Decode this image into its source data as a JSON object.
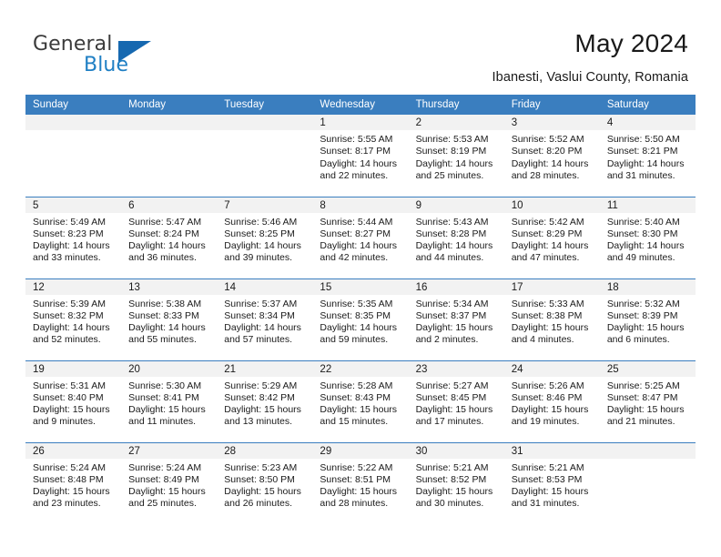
{
  "brand": {
    "name_part1": "General",
    "name_part2": "Blue",
    "triangle_icon": "triangle-logo-icon",
    "colors": {
      "general": "#3b3b3b",
      "blue": "#1f7fc4",
      "triangle": "#1668b0"
    }
  },
  "header": {
    "title": "May 2024",
    "location": "Ibanesti, Vaslui County, Romania"
  },
  "theme": {
    "header_bg": "#3a7ebf",
    "header_text": "#ffffff",
    "daynum_bg": "#f2f2f2",
    "divider": "#3a7ebf",
    "body_text": "#1a1a1a"
  },
  "weekdays": [
    "Sunday",
    "Monday",
    "Tuesday",
    "Wednesday",
    "Thursday",
    "Friday",
    "Saturday"
  ],
  "weeks": [
    [
      {
        "day": "",
        "sunrise": "",
        "sunset": "",
        "daylight1": "",
        "daylight2": "",
        "blank": true
      },
      {
        "day": "",
        "sunrise": "",
        "sunset": "",
        "daylight1": "",
        "daylight2": "",
        "blank": true
      },
      {
        "day": "",
        "sunrise": "",
        "sunset": "",
        "daylight1": "",
        "daylight2": "",
        "blank": true
      },
      {
        "day": "1",
        "sunrise": "Sunrise: 5:55 AM",
        "sunset": "Sunset: 8:17 PM",
        "daylight1": "Daylight: 14 hours",
        "daylight2": "and 22 minutes.",
        "blank": false
      },
      {
        "day": "2",
        "sunrise": "Sunrise: 5:53 AM",
        "sunset": "Sunset: 8:19 PM",
        "daylight1": "Daylight: 14 hours",
        "daylight2": "and 25 minutes.",
        "blank": false
      },
      {
        "day": "3",
        "sunrise": "Sunrise: 5:52 AM",
        "sunset": "Sunset: 8:20 PM",
        "daylight1": "Daylight: 14 hours",
        "daylight2": "and 28 minutes.",
        "blank": false
      },
      {
        "day": "4",
        "sunrise": "Sunrise: 5:50 AM",
        "sunset": "Sunset: 8:21 PM",
        "daylight1": "Daylight: 14 hours",
        "daylight2": "and 31 minutes.",
        "blank": false
      }
    ],
    [
      {
        "day": "5",
        "sunrise": "Sunrise: 5:49 AM",
        "sunset": "Sunset: 8:23 PM",
        "daylight1": "Daylight: 14 hours",
        "daylight2": "and 33 minutes.",
        "blank": false
      },
      {
        "day": "6",
        "sunrise": "Sunrise: 5:47 AM",
        "sunset": "Sunset: 8:24 PM",
        "daylight1": "Daylight: 14 hours",
        "daylight2": "and 36 minutes.",
        "blank": false
      },
      {
        "day": "7",
        "sunrise": "Sunrise: 5:46 AM",
        "sunset": "Sunset: 8:25 PM",
        "daylight1": "Daylight: 14 hours",
        "daylight2": "and 39 minutes.",
        "blank": false
      },
      {
        "day": "8",
        "sunrise": "Sunrise: 5:44 AM",
        "sunset": "Sunset: 8:27 PM",
        "daylight1": "Daylight: 14 hours",
        "daylight2": "and 42 minutes.",
        "blank": false
      },
      {
        "day": "9",
        "sunrise": "Sunrise: 5:43 AM",
        "sunset": "Sunset: 8:28 PM",
        "daylight1": "Daylight: 14 hours",
        "daylight2": "and 44 minutes.",
        "blank": false
      },
      {
        "day": "10",
        "sunrise": "Sunrise: 5:42 AM",
        "sunset": "Sunset: 8:29 PM",
        "daylight1": "Daylight: 14 hours",
        "daylight2": "and 47 minutes.",
        "blank": false
      },
      {
        "day": "11",
        "sunrise": "Sunrise: 5:40 AM",
        "sunset": "Sunset: 8:30 PM",
        "daylight1": "Daylight: 14 hours",
        "daylight2": "and 49 minutes.",
        "blank": false
      }
    ],
    [
      {
        "day": "12",
        "sunrise": "Sunrise: 5:39 AM",
        "sunset": "Sunset: 8:32 PM",
        "daylight1": "Daylight: 14 hours",
        "daylight2": "and 52 minutes.",
        "blank": false
      },
      {
        "day": "13",
        "sunrise": "Sunrise: 5:38 AM",
        "sunset": "Sunset: 8:33 PM",
        "daylight1": "Daylight: 14 hours",
        "daylight2": "and 55 minutes.",
        "blank": false
      },
      {
        "day": "14",
        "sunrise": "Sunrise: 5:37 AM",
        "sunset": "Sunset: 8:34 PM",
        "daylight1": "Daylight: 14 hours",
        "daylight2": "and 57 minutes.",
        "blank": false
      },
      {
        "day": "15",
        "sunrise": "Sunrise: 5:35 AM",
        "sunset": "Sunset: 8:35 PM",
        "daylight1": "Daylight: 14 hours",
        "daylight2": "and 59 minutes.",
        "blank": false
      },
      {
        "day": "16",
        "sunrise": "Sunrise: 5:34 AM",
        "sunset": "Sunset: 8:37 PM",
        "daylight1": "Daylight: 15 hours",
        "daylight2": "and 2 minutes.",
        "blank": false
      },
      {
        "day": "17",
        "sunrise": "Sunrise: 5:33 AM",
        "sunset": "Sunset: 8:38 PM",
        "daylight1": "Daylight: 15 hours",
        "daylight2": "and 4 minutes.",
        "blank": false
      },
      {
        "day": "18",
        "sunrise": "Sunrise: 5:32 AM",
        "sunset": "Sunset: 8:39 PM",
        "daylight1": "Daylight: 15 hours",
        "daylight2": "and 6 minutes.",
        "blank": false
      }
    ],
    [
      {
        "day": "19",
        "sunrise": "Sunrise: 5:31 AM",
        "sunset": "Sunset: 8:40 PM",
        "daylight1": "Daylight: 15 hours",
        "daylight2": "and 9 minutes.",
        "blank": false
      },
      {
        "day": "20",
        "sunrise": "Sunrise: 5:30 AM",
        "sunset": "Sunset: 8:41 PM",
        "daylight1": "Daylight: 15 hours",
        "daylight2": "and 11 minutes.",
        "blank": false
      },
      {
        "day": "21",
        "sunrise": "Sunrise: 5:29 AM",
        "sunset": "Sunset: 8:42 PM",
        "daylight1": "Daylight: 15 hours",
        "daylight2": "and 13 minutes.",
        "blank": false
      },
      {
        "day": "22",
        "sunrise": "Sunrise: 5:28 AM",
        "sunset": "Sunset: 8:43 PM",
        "daylight1": "Daylight: 15 hours",
        "daylight2": "and 15 minutes.",
        "blank": false
      },
      {
        "day": "23",
        "sunrise": "Sunrise: 5:27 AM",
        "sunset": "Sunset: 8:45 PM",
        "daylight1": "Daylight: 15 hours",
        "daylight2": "and 17 minutes.",
        "blank": false
      },
      {
        "day": "24",
        "sunrise": "Sunrise: 5:26 AM",
        "sunset": "Sunset: 8:46 PM",
        "daylight1": "Daylight: 15 hours",
        "daylight2": "and 19 minutes.",
        "blank": false
      },
      {
        "day": "25",
        "sunrise": "Sunrise: 5:25 AM",
        "sunset": "Sunset: 8:47 PM",
        "daylight1": "Daylight: 15 hours",
        "daylight2": "and 21 minutes.",
        "blank": false
      }
    ],
    [
      {
        "day": "26",
        "sunrise": "Sunrise: 5:24 AM",
        "sunset": "Sunset: 8:48 PM",
        "daylight1": "Daylight: 15 hours",
        "daylight2": "and 23 minutes.",
        "blank": false
      },
      {
        "day": "27",
        "sunrise": "Sunrise: 5:24 AM",
        "sunset": "Sunset: 8:49 PM",
        "daylight1": "Daylight: 15 hours",
        "daylight2": "and 25 minutes.",
        "blank": false
      },
      {
        "day": "28",
        "sunrise": "Sunrise: 5:23 AM",
        "sunset": "Sunset: 8:50 PM",
        "daylight1": "Daylight: 15 hours",
        "daylight2": "and 26 minutes.",
        "blank": false
      },
      {
        "day": "29",
        "sunrise": "Sunrise: 5:22 AM",
        "sunset": "Sunset: 8:51 PM",
        "daylight1": "Daylight: 15 hours",
        "daylight2": "and 28 minutes.",
        "blank": false
      },
      {
        "day": "30",
        "sunrise": "Sunrise: 5:21 AM",
        "sunset": "Sunset: 8:52 PM",
        "daylight1": "Daylight: 15 hours",
        "daylight2": "and 30 minutes.",
        "blank": false
      },
      {
        "day": "31",
        "sunrise": "Sunrise: 5:21 AM",
        "sunset": "Sunset: 8:53 PM",
        "daylight1": "Daylight: 15 hours",
        "daylight2": "and 31 minutes.",
        "blank": false
      },
      {
        "day": "",
        "sunrise": "",
        "sunset": "",
        "daylight1": "",
        "daylight2": "",
        "blank": true
      }
    ]
  ]
}
